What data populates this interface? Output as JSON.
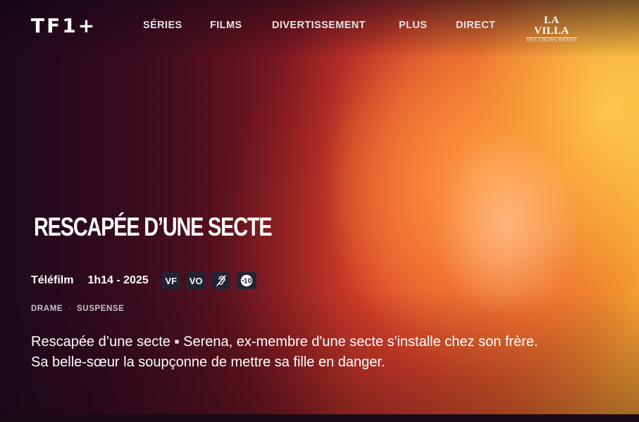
{
  "header": {
    "logo": "TF1+",
    "nav": [
      {
        "label": "SÉRIES"
      },
      {
        "label": "FILMS"
      },
      {
        "label": "DIVERTISSEMENT"
      },
      {
        "label": "PLUS"
      },
      {
        "label": "DIRECT"
      }
    ],
    "promo": {
      "main": "LA VILLA",
      "sub": "DES CŒURS BRISÉS"
    }
  },
  "program": {
    "title": "RESCAPÉE D’UNE SECTE",
    "type": "Téléfilm",
    "duration_year": "1h14 - 2025",
    "badges": [
      {
        "label": "VF",
        "icon": null
      },
      {
        "label": "VO",
        "icon": null
      },
      {
        "label": "",
        "icon": "hearing-impaired-icon"
      },
      {
        "label": "",
        "icon": "rating-10-icon"
      }
    ],
    "rating_label": "10",
    "genres": [
      "DRAME",
      "SUSPENSE"
    ],
    "genre_separator": "·",
    "synopsis": "Rescapée d’une secte ▪ Serena, ex-membre d'une secte s'installe chez son frère. Sa belle-sœur la soupçonne de mettre sa fille en danger."
  }
}
